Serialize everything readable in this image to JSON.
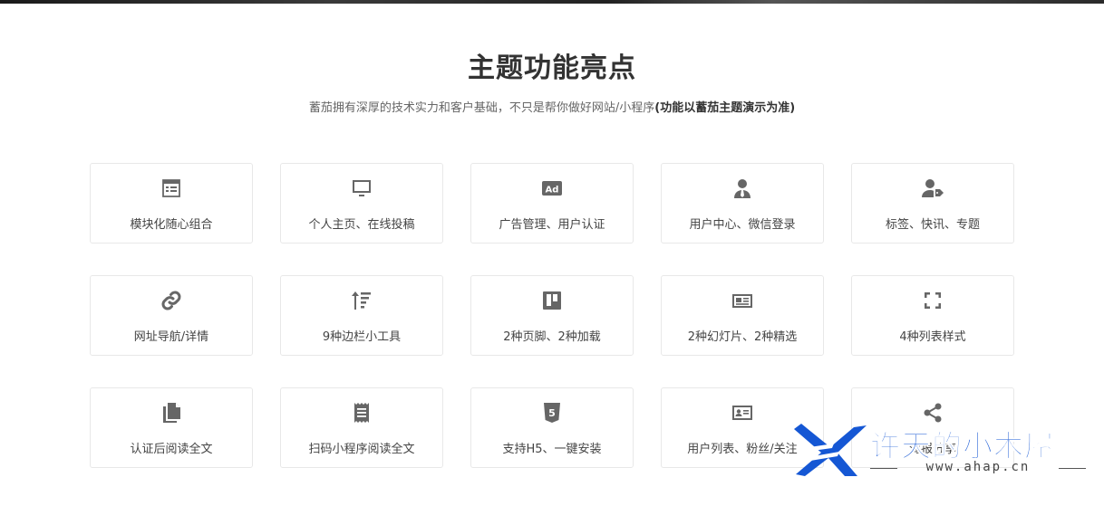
{
  "header": {
    "title": "主题功能亮点",
    "subtitle": "蓄茄拥有深厚的技术实力和客户基础，不只是帮你做好网站/小程序",
    "subtitle_bold": "(功能以蓄茄主题演示为准)"
  },
  "features": [
    {
      "icon": "newspaper-list-icon",
      "label": "模块化随心组合"
    },
    {
      "icon": "monitor-icon",
      "label": "个人主页、在线投稿"
    },
    {
      "icon": "ad-icon",
      "label": "广告管理、用户认证"
    },
    {
      "icon": "user-tie-icon",
      "label": "用户中心、微信登录"
    },
    {
      "icon": "user-tag-icon",
      "label": "标签、快讯、专题"
    },
    {
      "icon": "link-icon",
      "label": "网址导航/详情"
    },
    {
      "icon": "sort-amount-up-icon",
      "label": "9种边栏小工具"
    },
    {
      "icon": "trello-board-icon",
      "label": "2种页脚、2种加载"
    },
    {
      "icon": "newspaper-icon",
      "label": "2种幻灯片、2种精选"
    },
    {
      "icon": "expand-icon",
      "label": "4种列表样式"
    },
    {
      "icon": "copy-file-icon",
      "label": "认证后阅读全文"
    },
    {
      "icon": "receipt-icon",
      "label": "扫码小程序阅读全文"
    },
    {
      "icon": "html5-icon",
      "label": "支持H5、一键安装"
    },
    {
      "icon": "id-card-icon",
      "label": "用户列表、粉丝/关注"
    },
    {
      "icon": "share-icon",
      "label": "海报分享"
    }
  ],
  "watermark": {
    "name": "许天的小木屋",
    "url": "www.ahap.cn",
    "color": "#1557d4"
  }
}
